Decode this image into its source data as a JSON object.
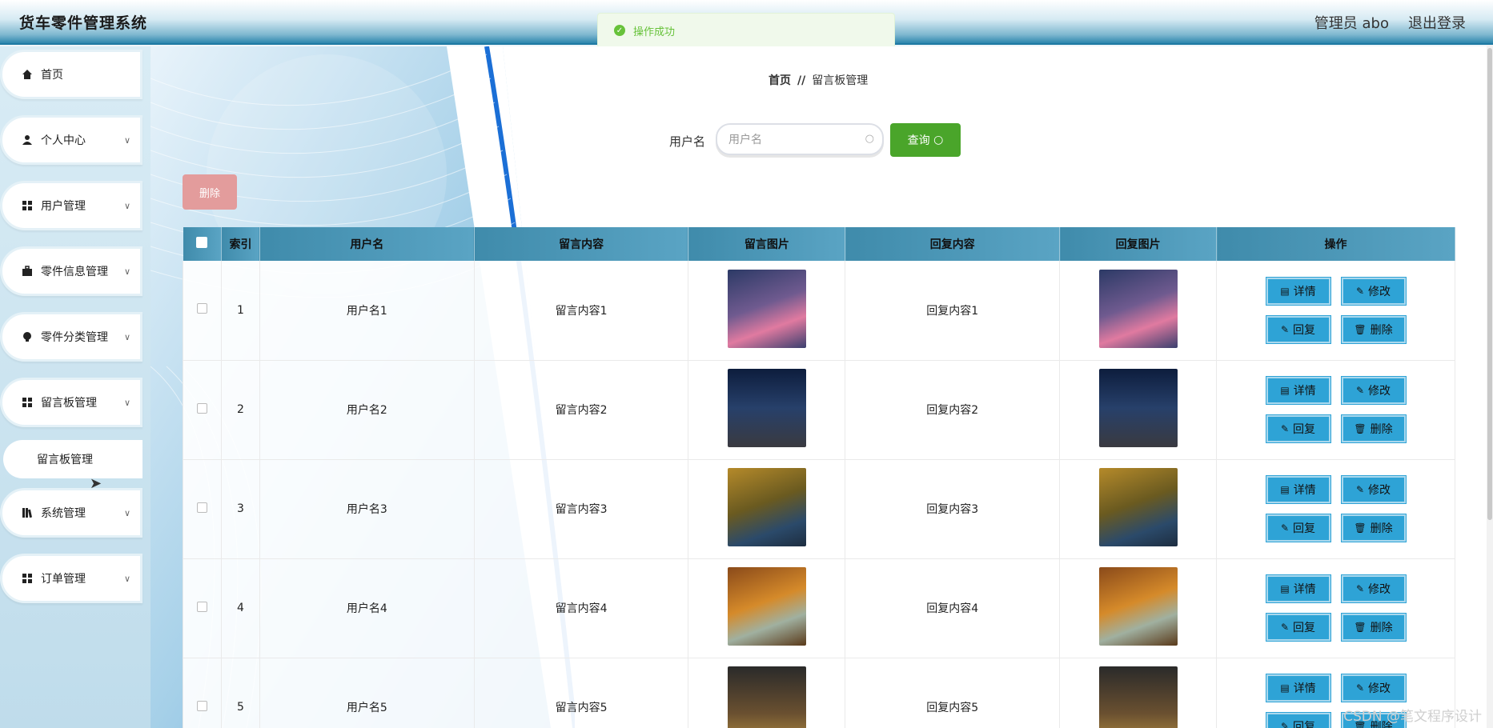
{
  "header": {
    "title": "货车零件管理系统",
    "user": "管理员 abo",
    "logout": "退出登录"
  },
  "toast": {
    "message": "操作成功"
  },
  "sidebar": {
    "items": [
      {
        "label": "首页",
        "icon": "home-icon"
      },
      {
        "label": "个人中心",
        "icon": "user-icon"
      },
      {
        "label": "用户管理",
        "icon": "grid-icon"
      },
      {
        "label": "零件信息管理",
        "icon": "briefcase-icon"
      },
      {
        "label": "零件分类管理",
        "icon": "bulb-icon"
      },
      {
        "label": "留言板管理",
        "icon": "grid-icon"
      },
      {
        "label": "系统管理",
        "icon": "library-icon"
      },
      {
        "label": "订单管理",
        "icon": "grid-icon"
      }
    ],
    "sub_item": "留言板管理"
  },
  "breadcrumb": {
    "home": "首页",
    "sep": "//",
    "current": "留言板管理"
  },
  "search": {
    "label": "用户名",
    "placeholder": "用户名",
    "button": "查询"
  },
  "toolbar": {
    "delete": "删除"
  },
  "table": {
    "columns": [
      "索引",
      "用户名",
      "留言内容",
      "留言图片",
      "回复内容",
      "回复图片",
      "操作"
    ],
    "rows": [
      {
        "index": "1",
        "username": "用户名1",
        "content": "留言内容1",
        "reply": "回复内容1"
      },
      {
        "index": "2",
        "username": "用户名2",
        "content": "留言内容2",
        "reply": "回复内容2"
      },
      {
        "index": "3",
        "username": "用户名3",
        "content": "留言内容3",
        "reply": "回复内容3"
      },
      {
        "index": "4",
        "username": "用户名4",
        "content": "留言内容4",
        "reply": "回复内容4"
      },
      {
        "index": "5",
        "username": "用户名5",
        "content": "留言内容5",
        "reply": "回复内容5"
      }
    ],
    "ops": {
      "detail": "详情",
      "edit": "修改",
      "reply": "回复",
      "delete": "删除"
    }
  },
  "watermark": "CSDN @笔文程序设计"
}
